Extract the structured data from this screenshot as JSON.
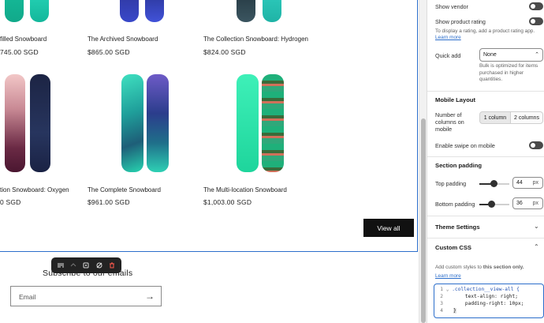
{
  "preview": {
    "products_top": [
      {
        "title": "filled Snowboard",
        "price": "745.00 SGD"
      },
      {
        "title": "The Archived Snowboard",
        "price": "$865.00 SGD"
      },
      {
        "title": "The Collection Snowboard: Hydrogen",
        "price": "$824.00 SGD"
      }
    ],
    "products_bottom": [
      {
        "title": "tion Snowboard: Oxygen",
        "price": "0 SGD"
      },
      {
        "title": "The Complete Snowboard",
        "price": "$961.00 SGD"
      },
      {
        "title": "The Multi-location Snowboard",
        "price": "$1,003.00 SGD"
      }
    ],
    "view_all_label": "View all",
    "newsletter_title": "Subscribe to our emails",
    "email_placeholder": "Email",
    "submit_arrow": "→"
  },
  "toolbar": {
    "icons": [
      "reorder-icon",
      "move-icon",
      "duplicate-icon",
      "hide-icon",
      "delete-icon"
    ]
  },
  "panel": {
    "show_vendor_label": "Show vendor",
    "show_rating_label": "Show product rating",
    "show_rating_help": "To display a rating, add a product rating app.",
    "learn_more": "Learn more",
    "quick_add_label": "Quick add",
    "quick_add_value": "None",
    "quick_add_help": "Bulk is optimized for items purchased in higher quantities.",
    "mobile_layout_heading": "Mobile Layout",
    "columns_label": "Number of columns on mobile",
    "column_options": [
      "1 column",
      "2 columns"
    ],
    "selected_column_option": "1 column",
    "swipe_label": "Enable swipe on mobile",
    "section_padding_heading": "Section padding",
    "top_padding_label": "Top padding",
    "top_padding_value": "44",
    "bottom_padding_label": "Bottom padding",
    "bottom_padding_value": "36",
    "padding_unit": "px",
    "theme_settings_heading": "Theme Settings",
    "custom_css_heading": "Custom CSS",
    "custom_css_help_prefix": "Add custom styles to ",
    "custom_css_help_bold": "this section only.",
    "code_lines": [
      {
        "n": "1",
        "text": ".collection__view-all {"
      },
      {
        "n": "2",
        "text": "    text-align: right;"
      },
      {
        "n": "3",
        "text": "    padding-right: 10px;"
      },
      {
        "n": "4",
        "text": "}"
      }
    ]
  },
  "colors": {
    "accent": "#2c6ecb",
    "button": "#111111",
    "toggle_off": "#4a4a4a"
  }
}
